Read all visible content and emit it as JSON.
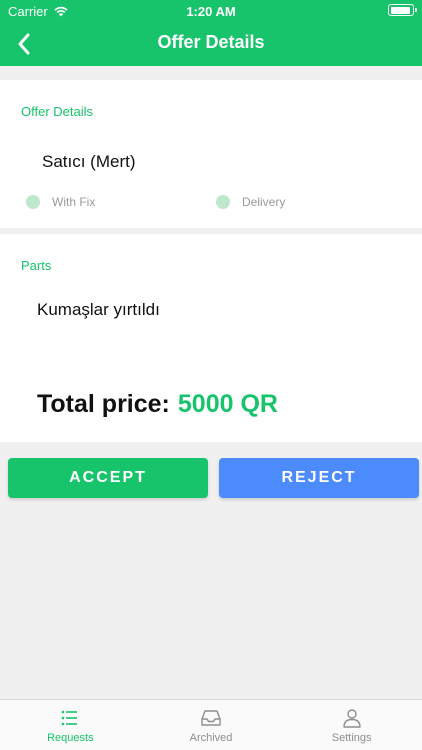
{
  "status_bar": {
    "carrier": "Carrier",
    "time": "1:20 AM"
  },
  "nav": {
    "title": "Offer Details"
  },
  "offer": {
    "section_title": "Offer Details",
    "seller": "Satıcı (Mert)",
    "options": [
      {
        "label": "With Fix"
      },
      {
        "label": "Delivery"
      }
    ]
  },
  "parts": {
    "section_title": "Parts",
    "description": "Kumaşlar yırtıldı",
    "total_label": "Total price:",
    "total_value": "5000 QR"
  },
  "actions": {
    "accept": "ACCEPT",
    "reject": "REJECT"
  },
  "tabs": [
    {
      "label": "Requests",
      "icon": "list-icon",
      "active": true
    },
    {
      "label": "Archived",
      "icon": "inbox-icon",
      "active": false
    },
    {
      "label": "Settings",
      "icon": "person-icon",
      "active": false
    }
  ],
  "colors": {
    "accent": "#17c46b",
    "reject": "#4b8bfb"
  }
}
